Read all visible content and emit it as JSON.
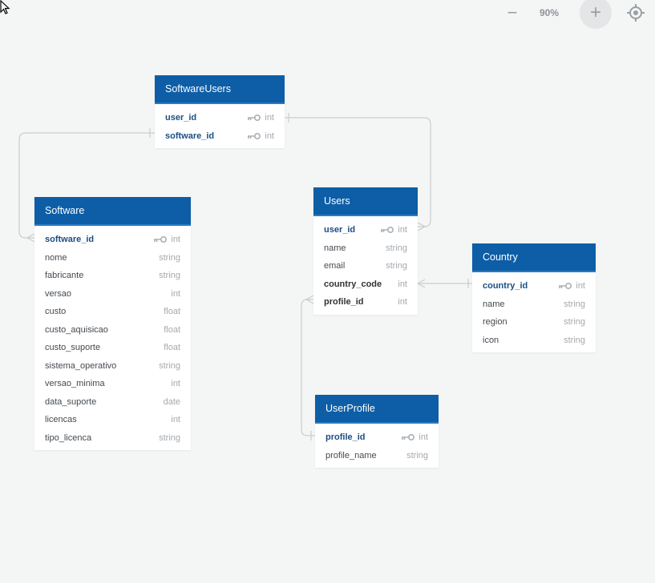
{
  "toolbar": {
    "zoom_out_symbol": "−",
    "zoom_level": "90%",
    "zoom_in_symbol": "+"
  },
  "colors": {
    "header": "#0d5ea6",
    "primary_key_text": "#1a4d86",
    "connector": "#c9cdd0",
    "background": "#f4f5f5"
  },
  "tables": {
    "software_users": {
      "name": "SoftwareUsers",
      "fields": [
        {
          "name": "user_id",
          "type": "int"
        },
        {
          "name": "software_id",
          "type": "int"
        }
      ]
    },
    "software": {
      "name": "Software",
      "fields": [
        {
          "name": "software_id",
          "type": "int"
        },
        {
          "name": "nome",
          "type": "string"
        },
        {
          "name": "fabricante",
          "type": "string"
        },
        {
          "name": "versao",
          "type": "int"
        },
        {
          "name": "custo",
          "type": "float"
        },
        {
          "name": "custo_aquisicao",
          "type": "float"
        },
        {
          "name": "custo_suporte",
          "type": "float"
        },
        {
          "name": "sistema_operativo",
          "type": "string"
        },
        {
          "name": "versao_minima",
          "type": "int"
        },
        {
          "name": "data_suporte",
          "type": "date"
        },
        {
          "name": "licencas",
          "type": "int"
        },
        {
          "name": "tipo_licenca",
          "type": "string"
        }
      ]
    },
    "users": {
      "name": "Users",
      "fields": [
        {
          "name": "user_id",
          "type": "int"
        },
        {
          "name": "name",
          "type": "string"
        },
        {
          "name": "email",
          "type": "string"
        },
        {
          "name": "country_code",
          "type": "int"
        },
        {
          "name": "profile_id",
          "type": "int"
        }
      ]
    },
    "country": {
      "name": "Country",
      "fields": [
        {
          "name": "country_id",
          "type": "int"
        },
        {
          "name": "name",
          "type": "string"
        },
        {
          "name": "region",
          "type": "string"
        },
        {
          "name": "icon",
          "type": "string"
        }
      ]
    },
    "user_profile": {
      "name": "UserProfile",
      "fields": [
        {
          "name": "profile_id",
          "type": "int"
        },
        {
          "name": "profile_name",
          "type": "string"
        }
      ]
    }
  }
}
